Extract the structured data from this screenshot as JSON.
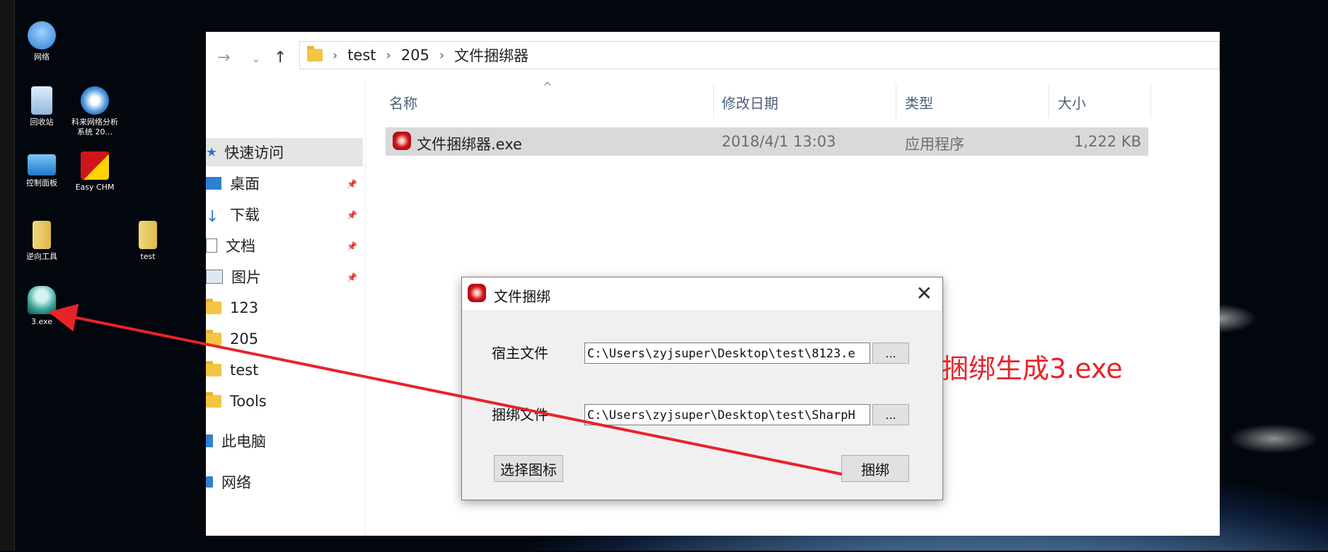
{
  "desktop": {
    "icons": [
      {
        "label": "网络"
      },
      {
        "label": "回收站"
      },
      {
        "label": "科来网络分析系统 20..."
      },
      {
        "label": "控制面板"
      },
      {
        "label": "Easy CHM"
      },
      {
        "label": "逆向工具"
      },
      {
        "label": "test"
      },
      {
        "label": "3.exe"
      }
    ]
  },
  "explorer": {
    "breadcrumb": [
      "test",
      "205",
      "文件捆绑器"
    ],
    "sidebar": [
      {
        "label": "快速访问",
        "icon": "star-icon"
      },
      {
        "label": "桌面",
        "icon": "desktop-icon",
        "pinned": true
      },
      {
        "label": "下载",
        "icon": "download-icon",
        "pinned": true
      },
      {
        "label": "文档",
        "icon": "document-icon",
        "pinned": true
      },
      {
        "label": "图片",
        "icon": "picture-icon",
        "pinned": true
      },
      {
        "label": "123",
        "icon": "folder-icon"
      },
      {
        "label": "205",
        "icon": "folder-icon"
      },
      {
        "label": "test",
        "icon": "folder-icon"
      },
      {
        "label": "Tools",
        "icon": "folder-icon"
      },
      {
        "label": "此电脑",
        "icon": "pc-icon"
      },
      {
        "label": "网络",
        "icon": "network-icon"
      }
    ],
    "columns": [
      "名称",
      "修改日期",
      "类型",
      "大小"
    ],
    "files": [
      {
        "name": "文件捆绑器.exe",
        "modified": "2018/4/1 13:03",
        "type": "应用程序",
        "size": "1,222 KB"
      }
    ]
  },
  "dialog": {
    "title": "文件捆绑",
    "host_label": "宿主文件",
    "host_value": "C:\\Users\\zyjsuper\\Desktop\\test\\8123.e",
    "bind_label": "捆绑文件",
    "bind_value": "C:\\Users\\zyjsuper\\Desktop\\test\\SharpH",
    "browse_label": "...",
    "choose_icon_label": "选择图标",
    "bind_button_label": "捆绑"
  },
  "annotation": {
    "text": "捆绑生成3.exe",
    "color": "#e8232a"
  }
}
